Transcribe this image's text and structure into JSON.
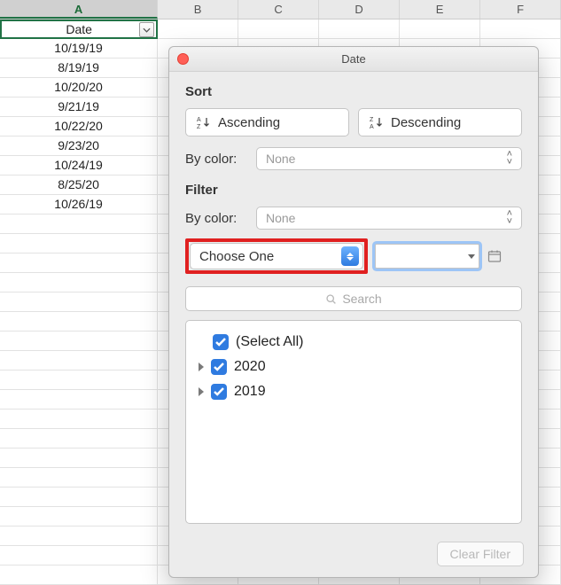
{
  "columns": [
    "A",
    "B",
    "C",
    "D",
    "E",
    "F"
  ],
  "header_cell": "Date",
  "data_rows": [
    "10/19/19",
    "8/19/19",
    "10/20/20",
    "9/21/19",
    "10/22/20",
    "9/23/20",
    "10/24/19",
    "8/25/20",
    "10/26/19"
  ],
  "blank_rows": 19,
  "dialog": {
    "title": "Date",
    "sort_label": "Sort",
    "ascending": "Ascending",
    "descending": "Descending",
    "by_color_label": "By color:",
    "by_color_value": "None",
    "filter_label": "Filter",
    "choose_one": "Choose One",
    "search_placeholder": "Search",
    "select_all": "(Select All)",
    "year_a": "2020",
    "year_b": "2019",
    "clear_filter": "Clear Filter"
  }
}
